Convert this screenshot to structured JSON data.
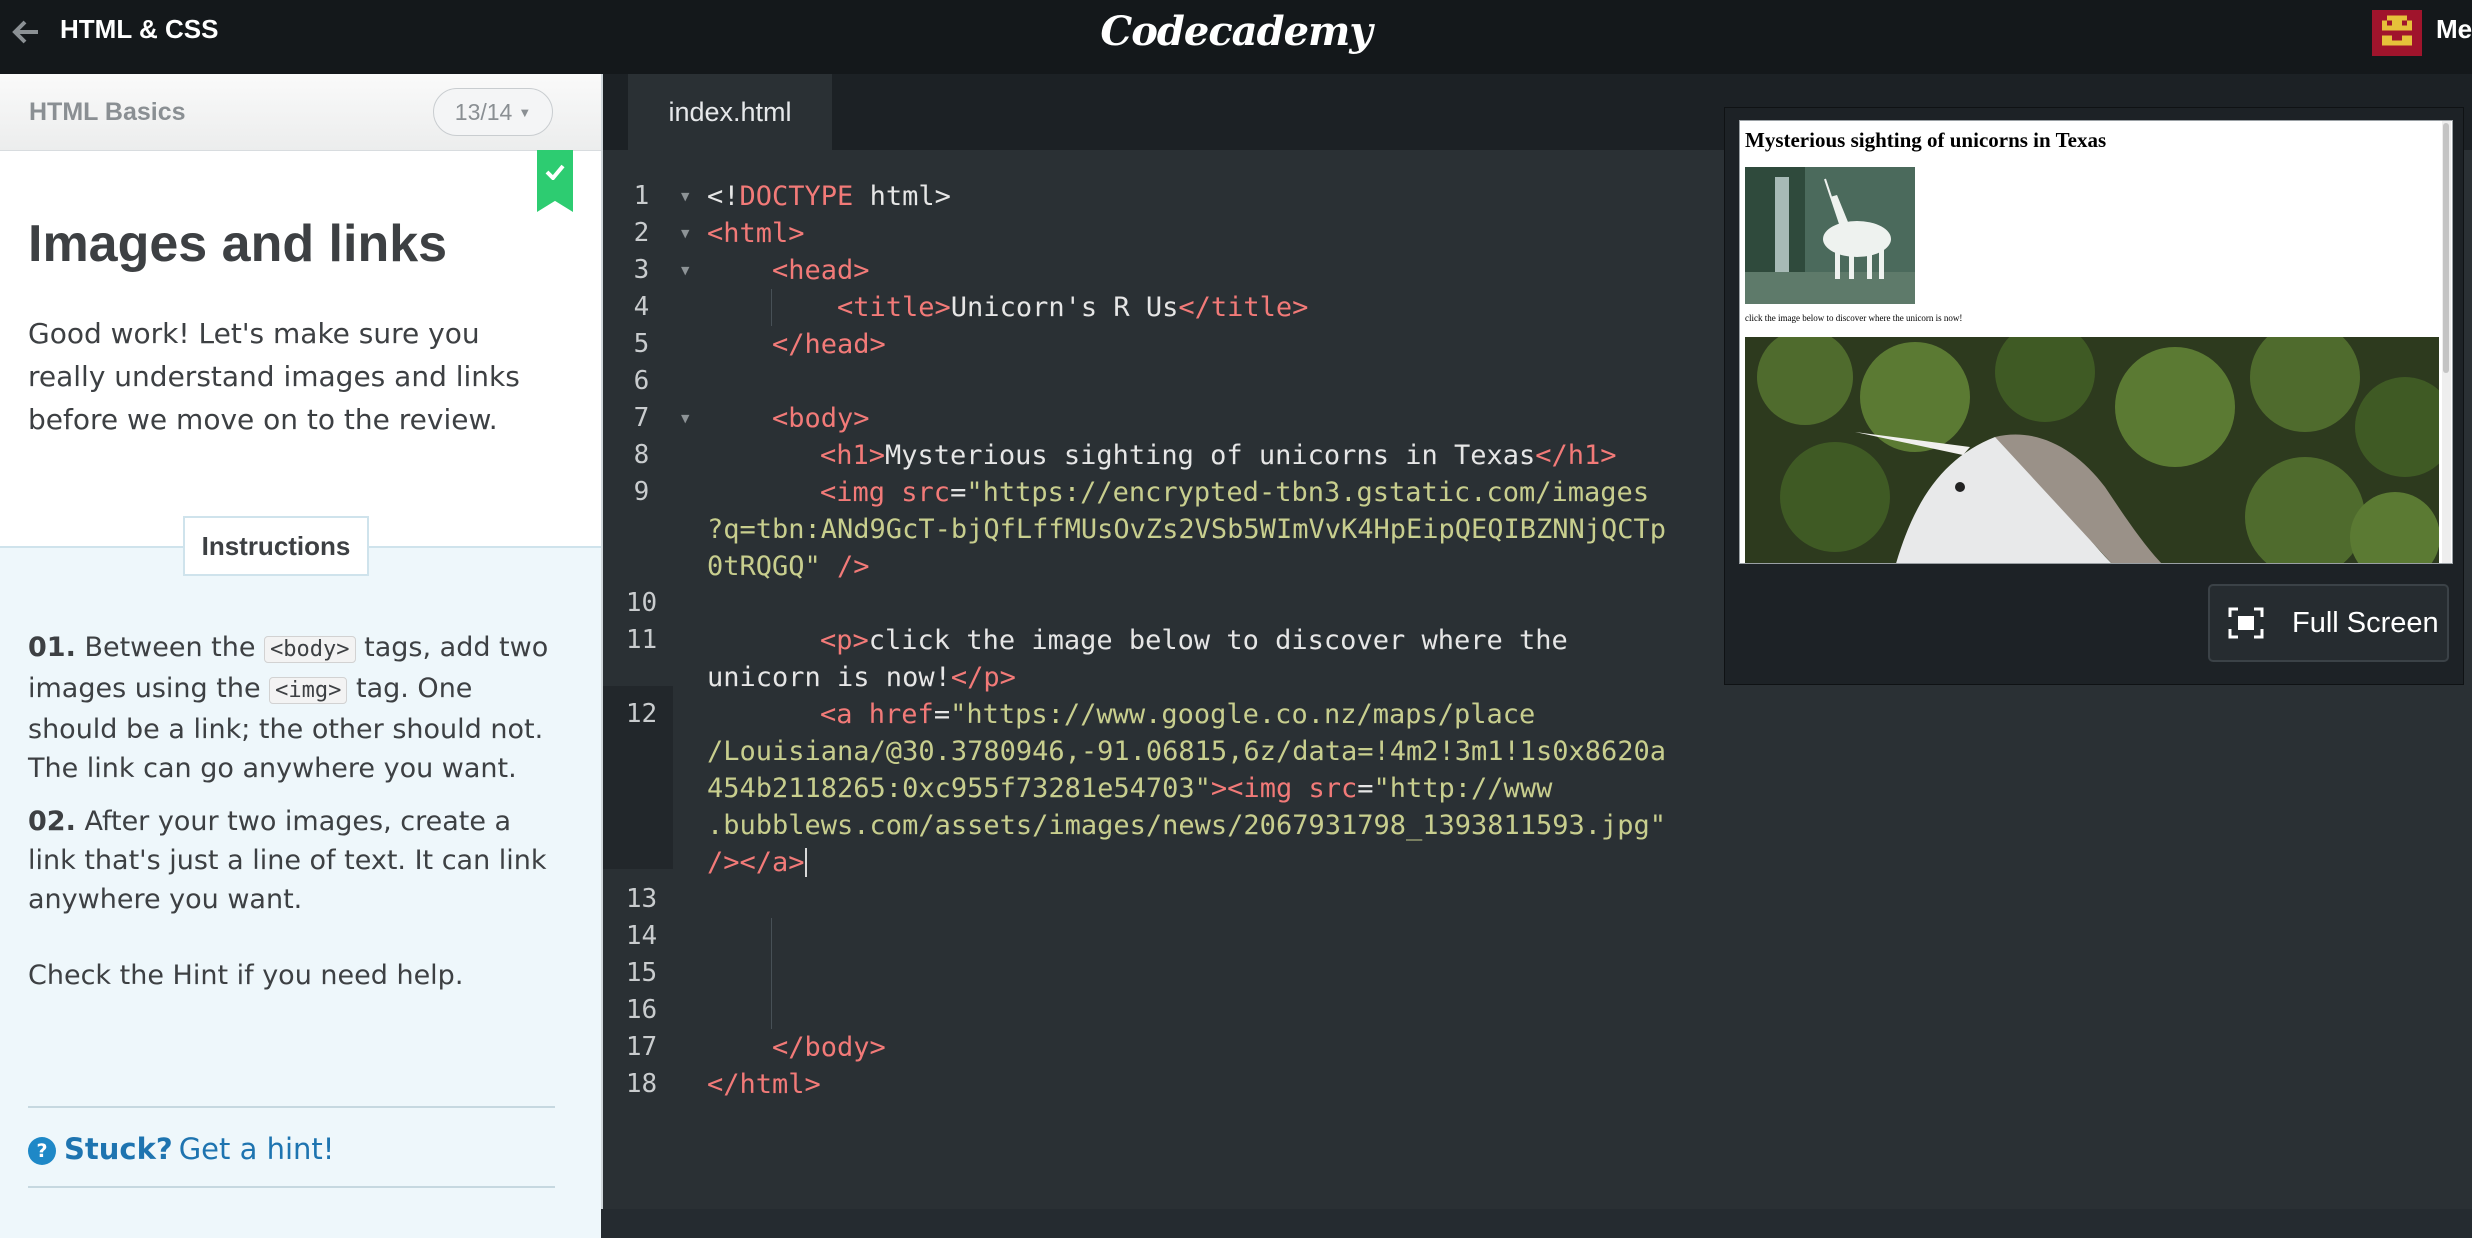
{
  "header": {
    "course_title": "HTML & CSS",
    "brand": "Codecademy",
    "user_label": "Me"
  },
  "lesson": {
    "section_name": "HTML Basics",
    "progress": "13/14",
    "completed": true,
    "title": "Images and links",
    "intro": "Good work! Let's make sure you really understand images and links before we move on to the review.",
    "instructions_tab": "Instructions",
    "steps": [
      {
        "num": "01.",
        "text_a": "Between the",
        "code_a": "<body>",
        "text_b": "tags, add two images using the",
        "code_b": "<img>",
        "text_c": "tag. One should be a link; the other should not. The link can go anywhere you want."
      },
      {
        "num": "02.",
        "text": "After your two images, create a link that's just a line of text. It can link anywhere you want."
      }
    ],
    "check_hint": "Check the Hint if you need help.",
    "stuck_label": "Stuck?",
    "hint_link": "Get a hint!"
  },
  "editor": {
    "file_tab": "index.html",
    "line_numbers": [
      "1",
      "2",
      "3",
      "4",
      "5",
      "6",
      "7",
      "8",
      "9",
      "10",
      "11",
      "12",
      "13",
      "14",
      "15",
      "16",
      "17",
      "18"
    ],
    "code": {
      "l1_lt": "<!",
      "l1_kw": "DOCTYPE",
      "l1_rest": " html>",
      "l2": "<html>",
      "l3": "<head>",
      "l4_open": "<title>",
      "l4_text": "Unicorn's R Us",
      "l4_close": "</title>",
      "l5": "</head>",
      "l7": "<body>",
      "l8_open": "<h1>",
      "l8_text": "Mysterious sighting of unicorns in Texas",
      "l8_close": "</h1>",
      "l9_tag": "<img",
      "l9_attr": "src",
      "l9_eq": "=",
      "l9_val_a": "\"https://encrypted-tbn3.gstatic.com/images",
      "l9_val_b": "?q=tbn:ANd9GcT-bjQfLffMUsOvZs2VSb5WImVvK4HpEipQEQIBZNNjQCTp",
      "l9_val_c": "0tRQGQ\"",
      "l9_end": " />",
      "l11_open": "<p>",
      "l11_text_a": "click the image below to discover where the",
      "l11_text_b": "unicorn is now!",
      "l11_close": "</p>",
      "l12_tag": "<a",
      "l12_attr": "href",
      "l12_eq": "=",
      "l12_val_a": "\"https://www.google.co.nz/maps/place",
      "l12_val_b": "/Louisiana/@30.3780946,-91.06815,6z/data=!4m2!3m1!1s0x8620a",
      "l12_val_c": "454b2118265:0xc955f73281e54703\"",
      "l12_img": "><img",
      "l12_attr2": "src",
      "l12_eq2": "=",
      "l12_val_d": "\"http://www",
      "l12_val_e": ".bubblews.com/assets/images/news/2067931798_1393811593.jpg\"",
      "l12_end": "/></a>",
      "l17": "</body>",
      "l18": "</html>"
    }
  },
  "preview": {
    "h1": "Mysterious sighting of unicorns in Texas",
    "paragraph": "click the image below to discover where the unicorn is now!",
    "fullscreen_label": "Full Screen"
  },
  "colors": {
    "topbar": "#14181b",
    "editor_bg": "#2a3034",
    "tag": "#f27a78",
    "string": "#c8ce8e",
    "accent_green": "#2dcc71",
    "link_blue": "#1e74b0"
  }
}
